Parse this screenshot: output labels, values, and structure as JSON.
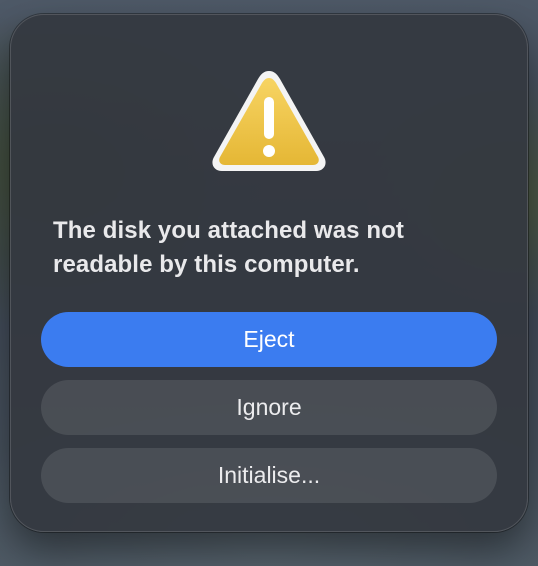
{
  "dialog": {
    "icon": "warning-triangle-icon",
    "message_line1": "The disk you attached was not",
    "message_line2": "readable by this computer.",
    "buttons": {
      "eject": "Eject",
      "ignore": "Ignore",
      "initialise": "Initialise..."
    }
  },
  "colors": {
    "primary_button": "#3b7cf0",
    "warning_yellow": "#f2c94c",
    "dialog_background": "#343840"
  }
}
